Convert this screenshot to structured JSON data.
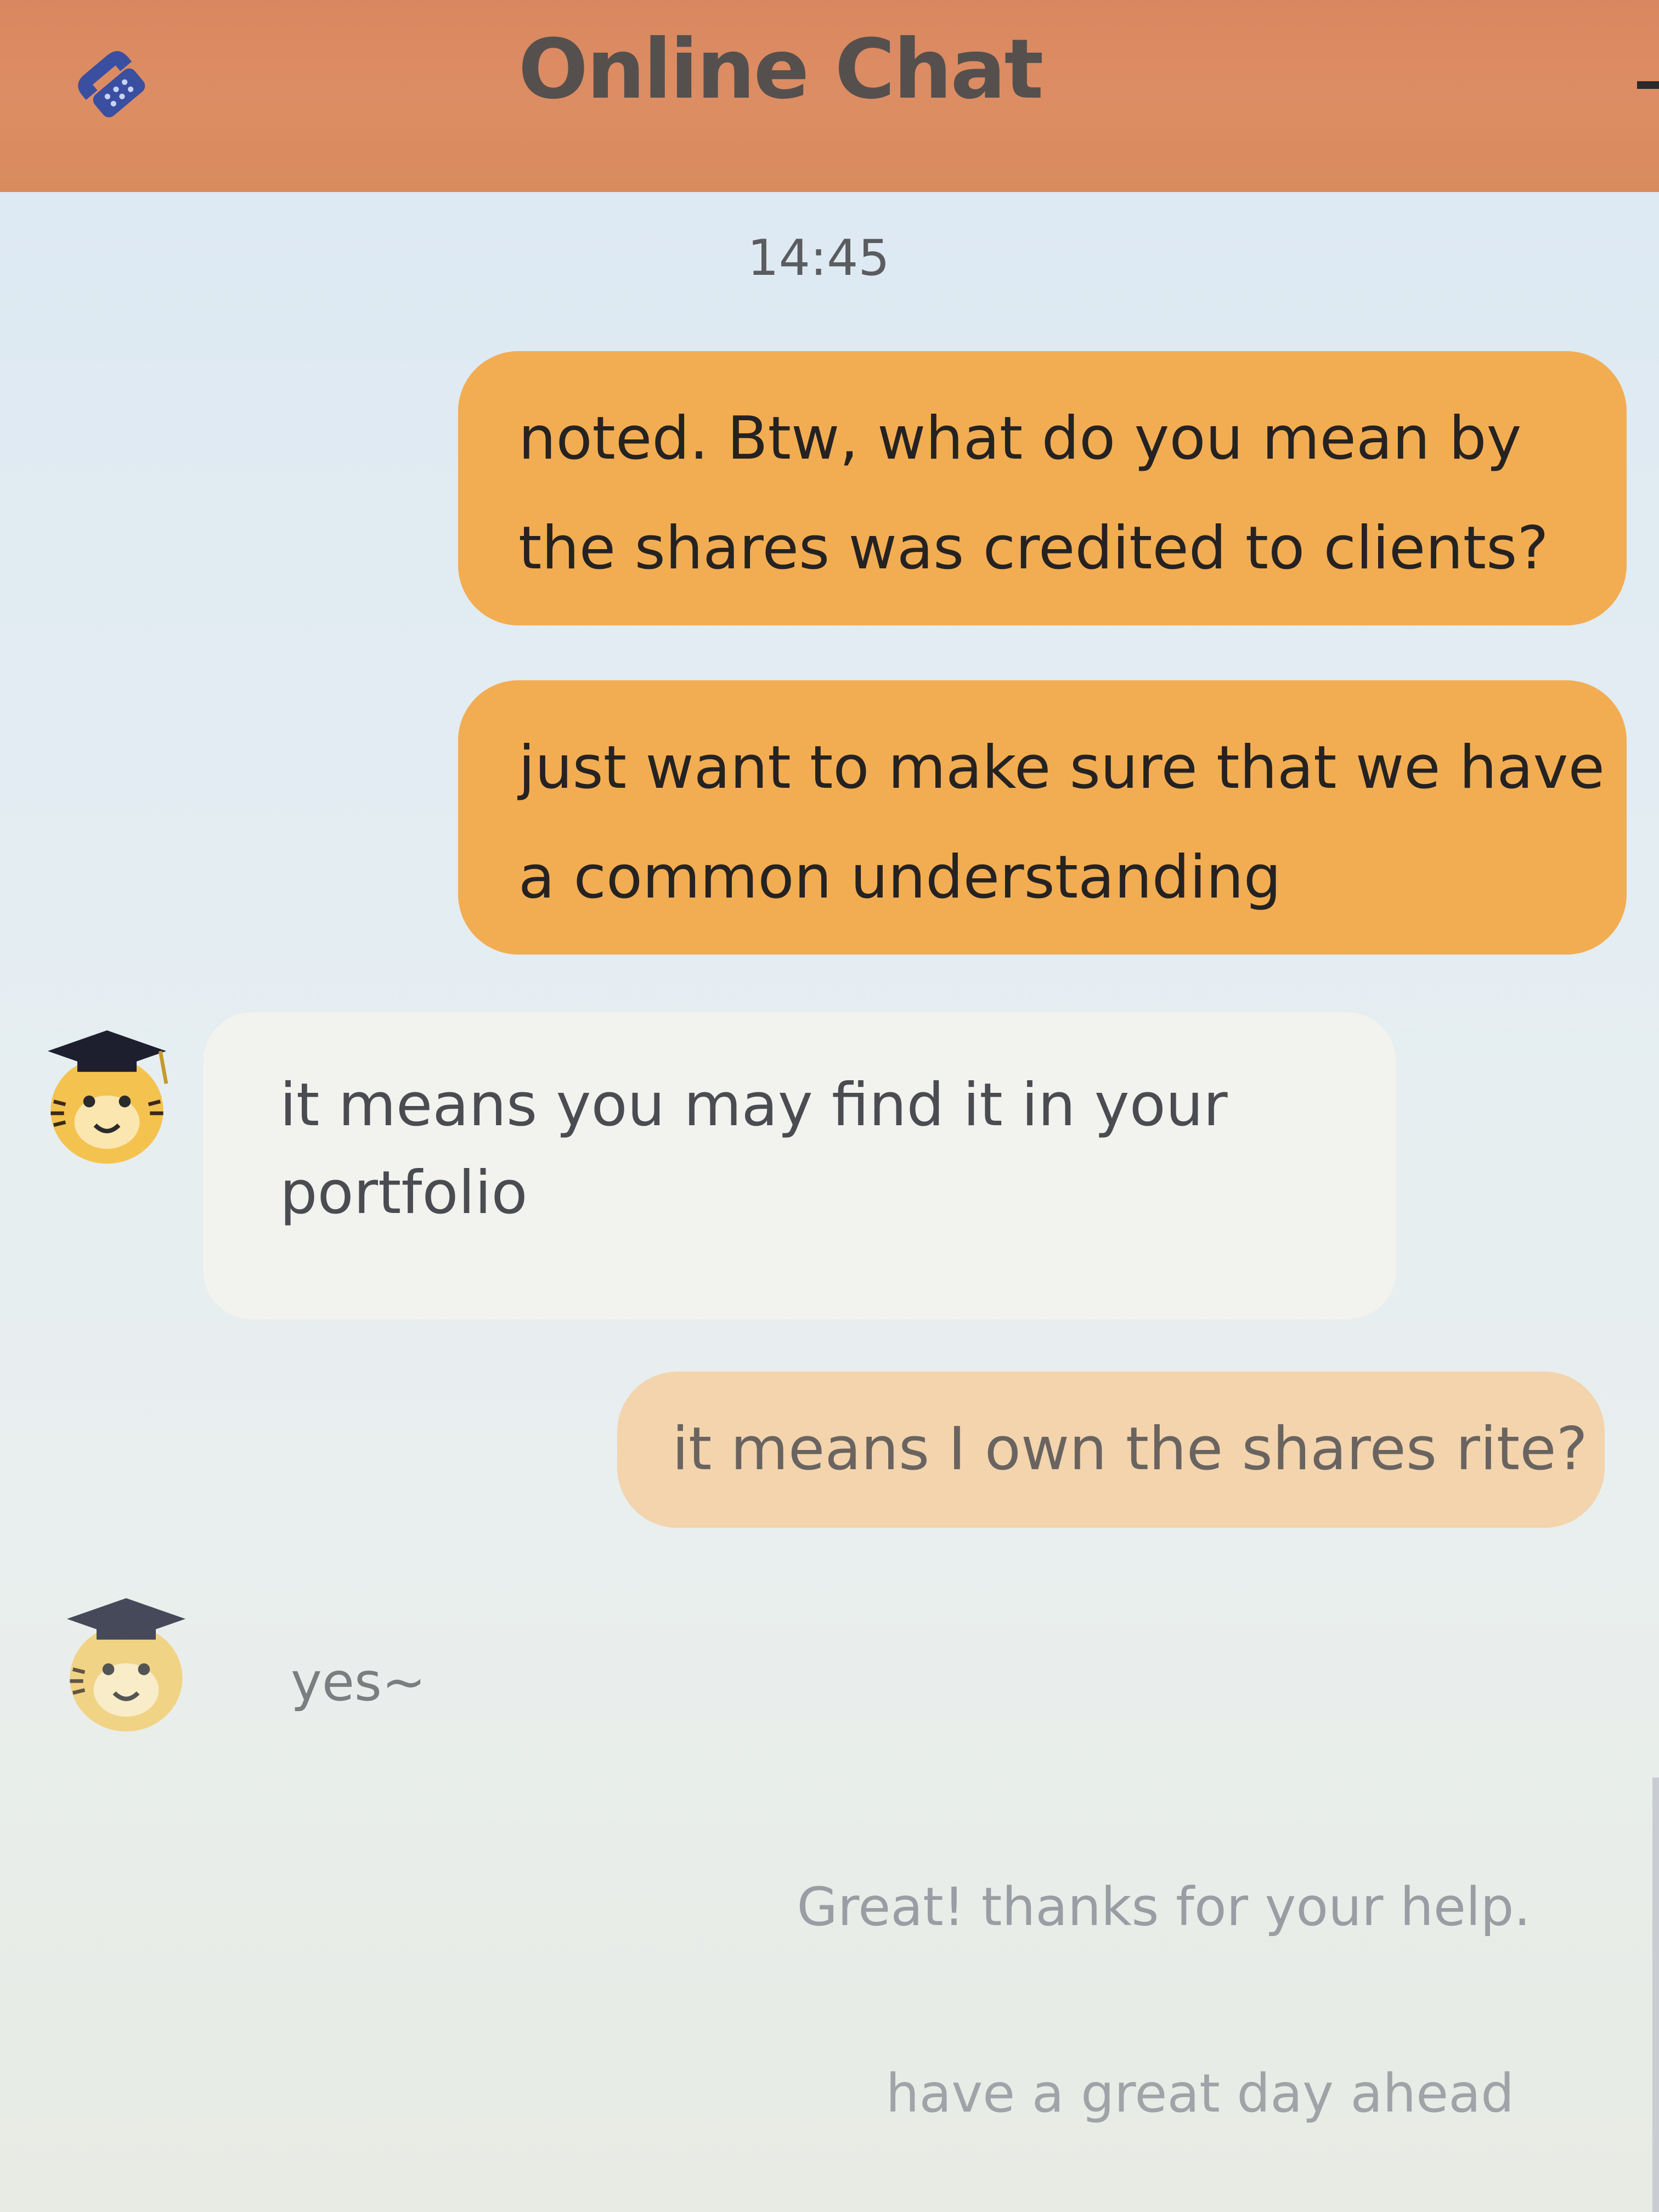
{
  "header": {
    "title": "Online Chat",
    "call_icon": "phone-icon",
    "minimize_icon": "minimize-icon",
    "background_color": "#dd8d63"
  },
  "timestamp": "14:45",
  "messages": [
    {
      "sender": "user",
      "lines": [
        "noted. Btw, what do you mean by",
        "the shares was credited to clients?"
      ]
    },
    {
      "sender": "user",
      "lines": [
        "just want to make sure that we have",
        "a common understanding"
      ]
    },
    {
      "sender": "agent",
      "avatar": "tiger-graduate-avatar",
      "lines": [
        "it means you may find it in your",
        "portfolio"
      ]
    },
    {
      "sender": "user",
      "lines": [
        "it means I own the shares rite?"
      ]
    },
    {
      "sender": "agent",
      "avatar": "tiger-graduate-avatar",
      "lines": [
        "yes~"
      ]
    },
    {
      "sender": "user",
      "lines": [
        "Great! thanks for your help."
      ]
    },
    {
      "sender": "user",
      "lines": [
        "have a great day ahead"
      ]
    }
  ],
  "colors": {
    "user_bubble": "#f2ad52",
    "agent_bubble": "#f2f2ee",
    "chat_background": "#dbe8f3"
  }
}
